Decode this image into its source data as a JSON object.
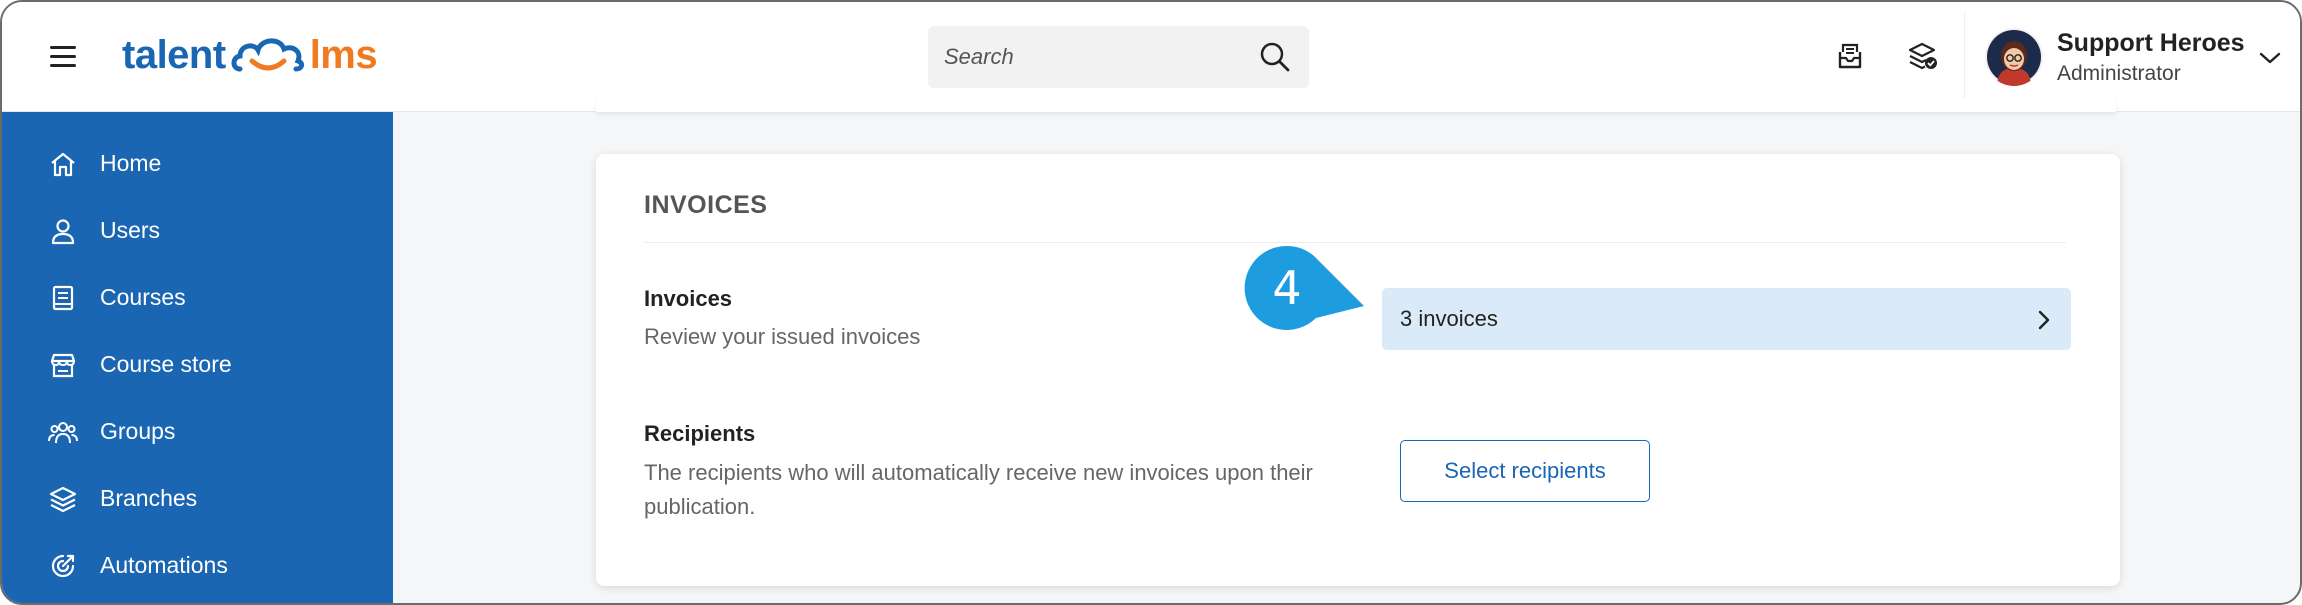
{
  "header": {
    "logo": {
      "part1": "talent",
      "part2": "lms"
    },
    "search": {
      "placeholder": "Search",
      "value": ""
    },
    "icons": [
      "menu-icon",
      "search-icon",
      "inbox-icon",
      "layers-check-icon",
      "chevron-down-icon"
    ],
    "user": {
      "name": "Support Heroes",
      "role": "Administrator"
    }
  },
  "sidebar": {
    "items": [
      {
        "label": "Home",
        "icon": "home-icon"
      },
      {
        "label": "Users",
        "icon": "user-icon"
      },
      {
        "label": "Courses",
        "icon": "book-icon"
      },
      {
        "label": "Course store",
        "icon": "store-icon"
      },
      {
        "label": "Groups",
        "icon": "groups-icon"
      },
      {
        "label": "Branches",
        "icon": "layers-icon"
      },
      {
        "label": "Automations",
        "icon": "automation-icon"
      }
    ]
  },
  "invoices_section": {
    "title": "INVOICES",
    "invoices": {
      "label": "Invoices",
      "description": "Review your issued invoices",
      "button_label": "3 invoices"
    },
    "recipients": {
      "label": "Recipients",
      "description_line1": "The recipients who will automatically receive new invoices upon their",
      "description_line2": "publication.",
      "button_label": "Select recipients"
    }
  },
  "callout": {
    "number": "4"
  },
  "colors": {
    "brand_blue": "#1b66b3",
    "brand_orange": "#f07a22",
    "callout_blue": "#1d9ce0",
    "highlight": "#dbeaf8"
  }
}
